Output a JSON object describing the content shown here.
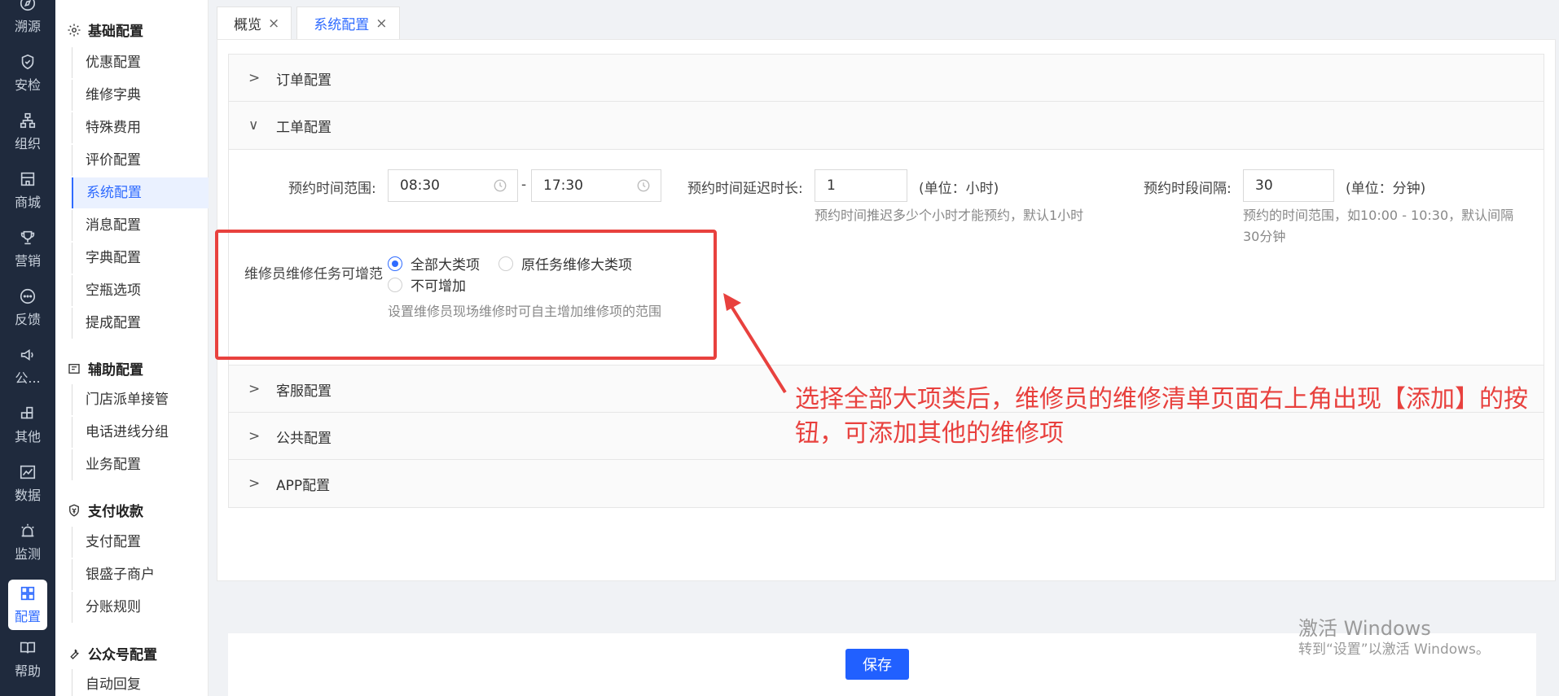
{
  "rail": {
    "items": [
      {
        "label": "溯源",
        "icon": "compass-icon"
      },
      {
        "label": "安检",
        "icon": "shield-check-icon"
      },
      {
        "label": "组织",
        "icon": "org-tree-icon"
      },
      {
        "label": "商城",
        "icon": "store-icon"
      },
      {
        "label": "营销",
        "icon": "trophy-icon"
      },
      {
        "label": "反馈",
        "icon": "chat-bubble-icon"
      },
      {
        "label": "公...",
        "icon": "megaphone-icon"
      },
      {
        "label": "其他",
        "icon": "plus-grid-icon"
      },
      {
        "label": "数据",
        "icon": "line-chart-icon"
      },
      {
        "label": "监测",
        "icon": "alarm-icon"
      },
      {
        "label": "配置",
        "icon": "grid-icon"
      },
      {
        "label": "帮助",
        "icon": "book-icon"
      }
    ],
    "active_index": 10
  },
  "sidebar": {
    "groups": [
      {
        "title": "基础配置",
        "icon": "gear-icon",
        "items": [
          "优惠配置",
          "维修字典",
          "特殊费用",
          "评价配置",
          "系统配置",
          "消息配置",
          "字典配置",
          "空瓶选项",
          "提成配置"
        ]
      },
      {
        "title": "辅助配置",
        "icon": "assist-icon",
        "items": [
          "门店派单接管",
          "电话进线分组",
          "业务配置"
        ]
      },
      {
        "title": "支付收款",
        "icon": "yen-shield-icon",
        "items": [
          "支付配置",
          "银盛子商户",
          "分账规则"
        ]
      },
      {
        "title": "公众号配置",
        "icon": "wrench-icon",
        "items": [
          "自动回复"
        ]
      }
    ],
    "active_item": "系统配置"
  },
  "tabs": [
    {
      "label": "概览",
      "close": "×"
    },
    {
      "label": "系统配置",
      "close": "×"
    }
  ],
  "sections": {
    "order": {
      "title": "订单配置",
      "chev": ">"
    },
    "workorder": {
      "title": "工单配置",
      "chev": "∨"
    },
    "service": {
      "title": "客服配置",
      "chev": ">"
    },
    "public": {
      "title": "公共配置",
      "chev": ">"
    },
    "app": {
      "title": "APP配置",
      "chev": ">"
    }
  },
  "workorder": {
    "time_range_label": "预约时间范围:",
    "time_start": "08:30",
    "time_sep": "-",
    "time_end": "17:30",
    "delay_label": "预约时间延迟时长:",
    "delay_value": "1",
    "delay_unit": "(单位：小时)",
    "delay_hint": "预约时间推迟多少个小时才能预约，默认1小时",
    "interval_label": "预约时段间隔:",
    "interval_value": "30",
    "interval_unit": "(单位：分钟)",
    "interval_hint": "预约的时间范围，如10:00 - 10:30，默认间隔30分钟",
    "scope_label": "维修员维修任务可增范",
    "scope_options": [
      "全部大类项",
      "原任务维修大类项",
      "不可增加"
    ],
    "scope_selected": "全部大类项",
    "scope_hint": "设置维修员现场维修时可自主增加维修项的范围"
  },
  "annotation": "选择全部大项类后，维修员的维修清单页面右上角出现【添加】的按钮，可添加其他的维修项",
  "save_label": "保存",
  "watermark": {
    "line1": "激活 Windows",
    "line2": "转到“设置”以激活 Windows。"
  },
  "colors": {
    "accent": "#2f6bff",
    "annotation": "#e8413e",
    "rail_bg": "#1f2a3d"
  }
}
